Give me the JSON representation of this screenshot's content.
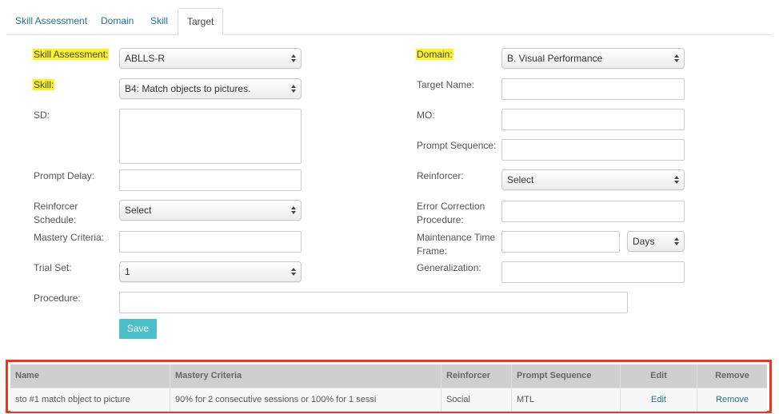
{
  "tabs": [
    {
      "label": "Skill Assessment"
    },
    {
      "label": "Domain"
    },
    {
      "label": "Skill"
    },
    {
      "label": "Target"
    }
  ],
  "form": {
    "skill_assessment": {
      "label": "Skill Assessment:",
      "value": "ABLLS-R"
    },
    "domain": {
      "label": "Domain:",
      "value": "B. Visual Performance"
    },
    "skill": {
      "label": "Skill:",
      "value": "B4: Match objects to pictures."
    },
    "target_name": {
      "label": "Target Name:",
      "value": ""
    },
    "sd": {
      "label": "SD:",
      "value": ""
    },
    "mo": {
      "label": "MO:",
      "value": ""
    },
    "prompt_sequence": {
      "label": "Prompt Sequence:",
      "value": ""
    },
    "prompt_delay": {
      "label": "Prompt Delay:",
      "value": ""
    },
    "reinforcer": {
      "label": "Reinforcer:",
      "value": "Select"
    },
    "reinforcer_schedule": {
      "label_line1": "Reinforcer",
      "label_line2": "Schedule:",
      "value": "Select"
    },
    "error_correction": {
      "label_line1": "Error Correction",
      "label_line2": "Procedure:",
      "value": ""
    },
    "mastery_criteria": {
      "label": "Mastery Criteria:",
      "value": ""
    },
    "maintenance_time_frame": {
      "label_line1": "Maintenance Time",
      "label_line2": "Frame:",
      "value": "",
      "unit": "Days"
    },
    "trial_set": {
      "label": "Trial Set:",
      "value": "1"
    },
    "generalization": {
      "label": "Generalization:",
      "value": ""
    },
    "procedure": {
      "label": "Procedure:",
      "value": ""
    },
    "save_label": "Save"
  },
  "table": {
    "headers": [
      "Name",
      "Mastery Criteria",
      "Reinforcer",
      "Prompt Sequence",
      "Edit",
      "Remove"
    ],
    "rows": [
      [
        "sto #1 match object to picture",
        "90% for 2 consecutive sessions or 100% for 1 sessi",
        "Social",
        "MTL",
        "Edit",
        "Remove"
      ]
    ]
  },
  "colors": {
    "highlight": "#f7f22a",
    "accent": "#4cc0c9",
    "link": "#2a6f91",
    "frame": "#e8391f"
  }
}
